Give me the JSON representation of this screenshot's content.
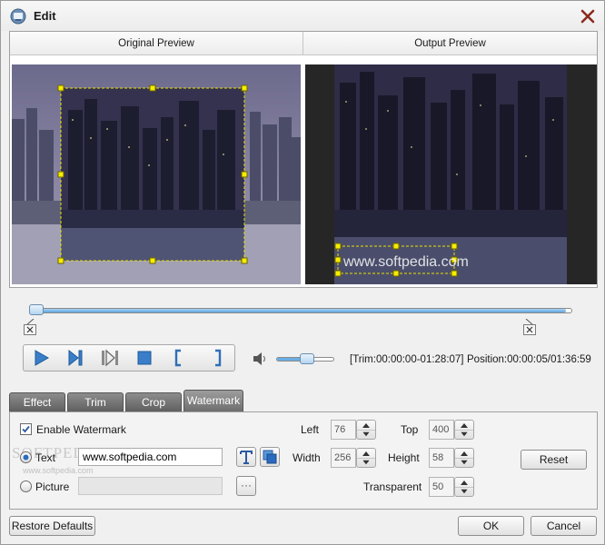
{
  "window": {
    "title": "Edit"
  },
  "preview": {
    "original_label": "Original Preview",
    "output_label": "Output Preview",
    "watermark_overlay_text": "www.softpedia.com"
  },
  "timeline": {
    "position_fraction": 0.0
  },
  "playback": {
    "volume_fraction": 0.55,
    "trim_text": "[Trim:00:00:00-01:28:07]",
    "position_text": "Position:00:00:05/01:36:59"
  },
  "tabs": [
    {
      "label": "Effect",
      "active": false
    },
    {
      "label": "Trim",
      "active": false
    },
    {
      "label": "Crop",
      "active": false
    },
    {
      "label": "Watermark",
      "active": true
    }
  ],
  "watermark": {
    "enable_label": "Enable Watermark",
    "enabled": true,
    "text_label": "Text",
    "text_value": "www.softpedia.com",
    "picture_label": "Picture",
    "picture_value": "",
    "browse_label": "···",
    "left_label": "Left",
    "left_value": "76",
    "top_label": "Top",
    "top_value": "400",
    "width_label": "Width",
    "width_value": "256",
    "height_label": "Height",
    "height_value": "58",
    "transparent_label": "Transparent",
    "transparent_value": "50",
    "reset_label": "Reset"
  },
  "footer": {
    "restore_label": "Restore Defaults",
    "ok_label": "OK",
    "cancel_label": "Cancel"
  },
  "softpedia_logo": {
    "main": "SOFTPEDIA",
    "sub": "www.softpedia.com"
  },
  "colors": {
    "accent": "#3a7ec9",
    "selection": "#e8e000",
    "tab": "#6e6e6e"
  }
}
